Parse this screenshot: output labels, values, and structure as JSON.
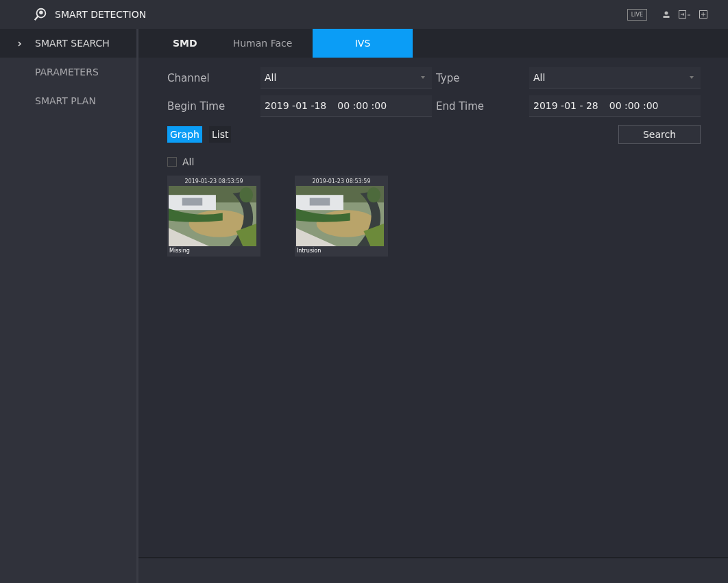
{
  "header": {
    "title": "SMART DETECTION",
    "live": "LIVE"
  },
  "sidebar": {
    "items": [
      {
        "label": "SMART SEARCH",
        "selected": true
      },
      {
        "label": "PARAMETERS",
        "selected": false
      },
      {
        "label": "SMART PLAN",
        "selected": false
      }
    ]
  },
  "tabs": [
    {
      "label": "SMD",
      "selected": false
    },
    {
      "label": "Human Face",
      "selected": false
    },
    {
      "label": "IVS",
      "selected": true
    }
  ],
  "filters": {
    "channel": {
      "label": "Channel",
      "value": "All"
    },
    "type": {
      "label": "Type",
      "value": "All"
    },
    "begin_time": {
      "label": "Begin Time",
      "date": "2019 -01 -18",
      "time": "00 :00 :00"
    },
    "end_time": {
      "label": "End Time",
      "date": "2019 -01 - 28",
      "time": "00 :00 :00"
    }
  },
  "view_modes": [
    {
      "label": "Graph",
      "selected": true
    },
    {
      "label": "List",
      "selected": false
    }
  ],
  "search_button": "Search",
  "select_all": {
    "label": "All",
    "checked": false
  },
  "results": [
    {
      "timestamp": "2019-01-23 08:53:59",
      "caption": "Missing"
    },
    {
      "timestamp": "2019-01-23 08:53:59",
      "caption": "Intrusion"
    }
  ]
}
